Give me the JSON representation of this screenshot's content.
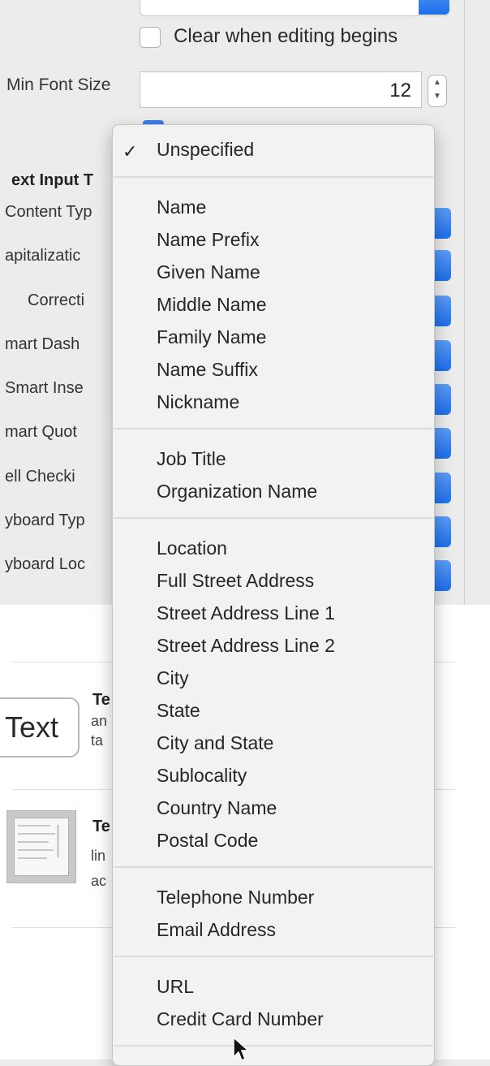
{
  "inspector": {
    "clear_checkbox_label": "Clear when editing begins",
    "min_font_label": "Min Font Size",
    "min_font_value": "12",
    "section_header": "ext Input T",
    "rows": [
      {
        "label": "Content Typ"
      },
      {
        "label": "apitalizatic"
      },
      {
        "label": "Correcti"
      },
      {
        "label": "mart Dash"
      },
      {
        "label": "Smart Inse"
      },
      {
        "label": "mart Quot"
      },
      {
        "label": "ell Checki"
      },
      {
        "label": "yboard Typ"
      },
      {
        "label": "yboard Loc"
      }
    ]
  },
  "library": {
    "text_field": {
      "icon_text": "Text",
      "title": "Te",
      "desc_lines": [
        "an",
        "ta"
      ]
    },
    "text_view": {
      "title": "Te",
      "desc_lines": [
        "lin",
        "ac"
      ]
    }
  },
  "menu": {
    "selected": "Unspecified",
    "groups": [
      [
        "Unspecified"
      ],
      [
        "Name",
        "Name Prefix",
        "Given Name",
        "Middle Name",
        "Family Name",
        "Name Suffix",
        "Nickname"
      ],
      [
        "Job Title",
        "Organization Name"
      ],
      [
        "Location",
        "Full Street Address",
        "Street Address Line 1",
        "Street Address Line 2",
        "City",
        "State",
        "City and State",
        "Sublocality",
        "Country Name",
        "Postal Code"
      ],
      [
        "Telephone Number",
        "Email Address"
      ],
      [
        "URL",
        "Credit Card Number"
      ]
    ]
  },
  "colors": {
    "accent": "#1e6fea",
    "menu_bg": "#f2f2f2",
    "panel_bg": "#ececec"
  }
}
